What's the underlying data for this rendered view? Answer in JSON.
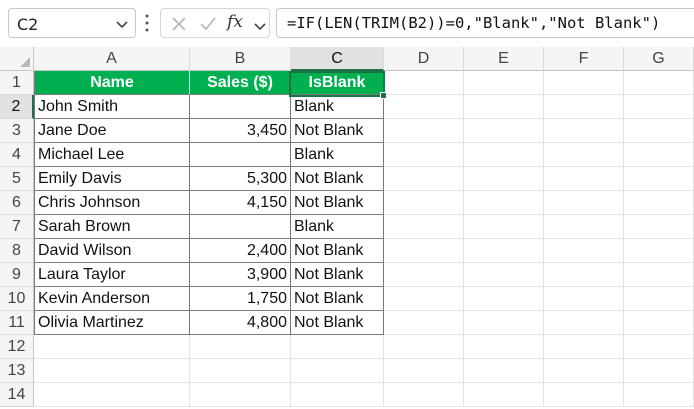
{
  "formula_bar": {
    "name_box": "C2",
    "formula": "=IF(LEN(TRIM(B2))=0,\"Blank\",\"Not Blank\")",
    "fx_label": "fx"
  },
  "columns": [
    "A",
    "B",
    "C",
    "D",
    "E",
    "F",
    "G"
  ],
  "rows": [
    "1",
    "2",
    "3",
    "4",
    "5",
    "6",
    "7",
    "8",
    "9",
    "10",
    "11",
    "12",
    "13",
    "14"
  ],
  "table": {
    "headers": [
      "Name",
      "Sales ($)",
      "IsBlank"
    ],
    "rows": [
      [
        "John Smith",
        "",
        "Blank"
      ],
      [
        "Jane Doe",
        "3,450",
        "Not Blank"
      ],
      [
        "Michael Lee",
        "",
        "Blank"
      ],
      [
        "Emily Davis",
        "5,300",
        "Not Blank"
      ],
      [
        "Chris Johnson",
        "4,150",
        "Not Blank"
      ],
      [
        "Sarah Brown",
        "",
        "Blank"
      ],
      [
        "David Wilson",
        "2,400",
        "Not Blank"
      ],
      [
        "Laura Taylor",
        "3,900",
        "Not Blank"
      ],
      [
        "Kevin Anderson",
        "1,750",
        "Not Blank"
      ],
      [
        "Olivia Martinez",
        "4,800",
        "Not Blank"
      ]
    ]
  },
  "colors": {
    "header_fill": "#00b050",
    "header_text": "#ffffff",
    "selection_accent": "#1e7145"
  },
  "icons": {
    "cancel": "x-icon",
    "enter": "check-icon",
    "function": "fx-icon",
    "name_box_dropdown": "chevron-down-icon",
    "formula_dropdown": "chevron-down-icon"
  }
}
